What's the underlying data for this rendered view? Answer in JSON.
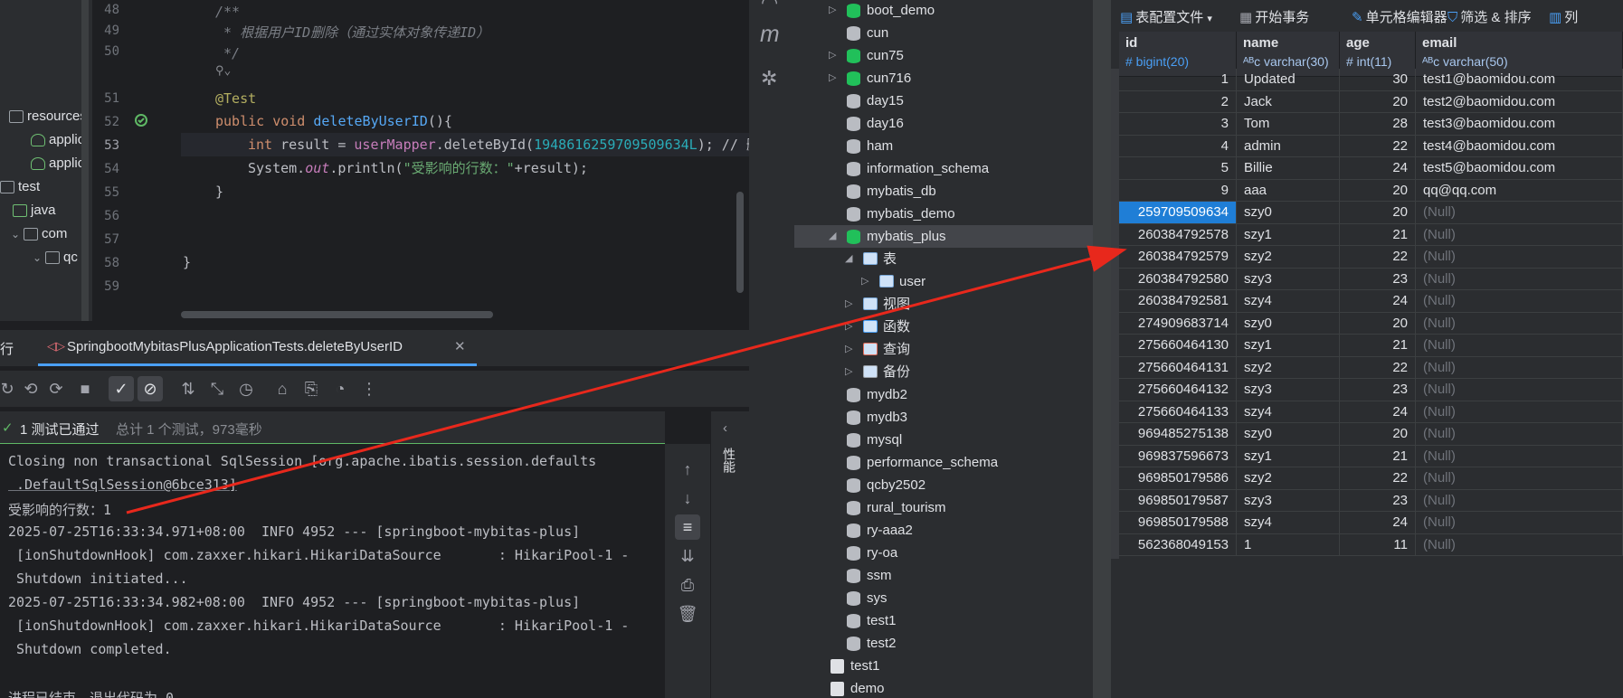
{
  "project_tree": {
    "items": [
      {
        "label": "resources",
        "icon": "folder-icon"
      },
      {
        "label": "applic",
        "icon": "leaf-icon"
      },
      {
        "label": "applic",
        "icon": "leaf-icon"
      },
      {
        "label": "test",
        "icon": "folder-icon"
      },
      {
        "label": "java",
        "icon": "folder-icon"
      },
      {
        "label": "com",
        "icon": "package-icon"
      },
      {
        "label": "qc",
        "icon": "package-icon"
      }
    ]
  },
  "editor": {
    "line_numbers": [
      "48",
      "49",
      "50",
      "51",
      "52",
      "53",
      "54",
      "55",
      "56",
      "57",
      "58",
      "59"
    ],
    "comment_1": "/**",
    "comment_2": " * 根据用户ID删除（通过实体对象传递ID）",
    "comment_3": " */",
    "annotation": "@Test",
    "kw_public": "public",
    "kw_void": "void",
    "method_name": "deleteByUserID",
    "method_tail": "(){",
    "kw_int": "int",
    "var_decl": " result = ",
    "mapper_field": "userMapper",
    "call": ".deleteById(",
    "id_literal": "1948616259709509634L",
    "call_tail": "); // 删",
    "println_start": "System.",
    "println_out": "out",
    "println_mid": ".println(",
    "println_str": "\"受影响的行数：\"",
    "println_tail": "+result);",
    "close_method": "}",
    "close_class": "}"
  },
  "run_panel": {
    "tab_prefix": "行",
    "tab_label": "SpringbootMybitasPlusApplicationTests.deleteByUserID",
    "status_passed": "1 测试已通过",
    "status_summary": "总计 1 个测试，973毫秒",
    "side_label": "性能",
    "console_lines": [
      "Closing non transactional SqlSession [org.apache.ibatis.session.defaults",
      " .DefaultSqlSession@6bce313]",
      "受影响的行数：1",
      "2025-07-25T16:33:34.971+08:00  INFO 4952 --- [springboot-mybitas-plus]",
      " [ionShutdownHook] com.zaxxer.hikari.HikariDataSource       : HikariPool-1 -",
      " Shutdown initiated...",
      "2025-07-25T16:33:34.982+08:00  INFO 4952 --- [springboot-mybitas-plus]",
      " [ionShutdownHook] com.zaxxer.hikari.HikariDataSource       : HikariPool-1 -",
      " Shutdown completed.",
      "",
      "进程已结束，退出代码为 0"
    ]
  },
  "db_nav": {
    "items": [
      {
        "label": "boot_demo",
        "kind": "db",
        "color": "#21c05a",
        "level": 0,
        "expand": "collapsed"
      },
      {
        "label": "cun",
        "kind": "db",
        "color": "#b9bcc2",
        "level": 0,
        "expand": "none"
      },
      {
        "label": "cun75",
        "kind": "db",
        "color": "#21c05a",
        "level": 0,
        "expand": "collapsed"
      },
      {
        "label": "cun716",
        "kind": "db",
        "color": "#21c05a",
        "level": 0,
        "expand": "collapsed"
      },
      {
        "label": "day15",
        "kind": "db",
        "color": "#b9bcc2",
        "level": 0,
        "expand": "none"
      },
      {
        "label": "day16",
        "kind": "db",
        "color": "#b9bcc2",
        "level": 0,
        "expand": "none"
      },
      {
        "label": "ham",
        "kind": "db",
        "color": "#b9bcc2",
        "level": 0,
        "expand": "none"
      },
      {
        "label": "information_schema",
        "kind": "db",
        "color": "#b9bcc2",
        "level": 0,
        "expand": "none"
      },
      {
        "label": "mybatis_db",
        "kind": "db",
        "color": "#b9bcc2",
        "level": 0,
        "expand": "none"
      },
      {
        "label": "mybatis_demo",
        "kind": "db",
        "color": "#b9bcc2",
        "level": 0,
        "expand": "none"
      },
      {
        "label": "mybatis_plus",
        "kind": "db",
        "color": "#21c05a",
        "level": 0,
        "expand": "expanded",
        "selected": true
      },
      {
        "label": "表",
        "kind": "folder",
        "color": "#7aa8d8",
        "level": 1,
        "expand": "expanded"
      },
      {
        "label": "user",
        "kind": "table",
        "color": "#7aa8d8",
        "level": 2,
        "expand": "collapsed"
      },
      {
        "label": "视图",
        "kind": "view",
        "color": "#7aa8d8",
        "level": 1,
        "expand": "collapsed"
      },
      {
        "label": "函数",
        "kind": "function",
        "color": "#4a9ff5",
        "level": 1,
        "expand": "collapsed"
      },
      {
        "label": "查询",
        "kind": "query",
        "color": "#e06c5a",
        "level": 1,
        "expand": "collapsed"
      },
      {
        "label": "备份",
        "kind": "backup",
        "color": "#9aa0a6",
        "level": 1,
        "expand": "collapsed"
      },
      {
        "label": "mydb2",
        "kind": "db",
        "color": "#b9bcc2",
        "level": 0,
        "expand": "none"
      },
      {
        "label": "mydb3",
        "kind": "db",
        "color": "#b9bcc2",
        "level": 0,
        "expand": "none"
      },
      {
        "label": "mysql",
        "kind": "db",
        "color": "#b9bcc2",
        "level": 0,
        "expand": "none"
      },
      {
        "label": "performance_schema",
        "kind": "db",
        "color": "#b9bcc2",
        "level": 0,
        "expand": "none"
      },
      {
        "label": "qcby2502",
        "kind": "db",
        "color": "#b9bcc2",
        "level": 0,
        "expand": "none"
      },
      {
        "label": "rural_tourism",
        "kind": "db",
        "color": "#b9bcc2",
        "level": 0,
        "expand": "none"
      },
      {
        "label": "ry-aaa2",
        "kind": "db",
        "color": "#b9bcc2",
        "level": 0,
        "expand": "none"
      },
      {
        "label": "ry-oa",
        "kind": "db",
        "color": "#b9bcc2",
        "level": 0,
        "expand": "none"
      },
      {
        "label": "ssm",
        "kind": "db",
        "color": "#b9bcc2",
        "level": 0,
        "expand": "none"
      },
      {
        "label": "sys",
        "kind": "db",
        "color": "#b9bcc2",
        "level": 0,
        "expand": "none"
      },
      {
        "label": "test1",
        "kind": "db",
        "color": "#b9bcc2",
        "level": 0,
        "expand": "none"
      },
      {
        "label": "test2",
        "kind": "db",
        "color": "#b9bcc2",
        "level": 0,
        "expand": "none"
      },
      {
        "label": "test1",
        "kind": "connection",
        "color": "#dfe1e5",
        "level": -1,
        "expand": "none"
      },
      {
        "label": "demo",
        "kind": "connection",
        "color": "#dfe1e5",
        "level": -1,
        "expand": "none"
      }
    ]
  },
  "table_view": {
    "toolbar": {
      "config_label": "表配置文件",
      "begin_tx_label": "开始事务",
      "cell_editor_label": "单元格编辑器",
      "filter_sort_label": "筛选 & 排序",
      "columns_label": "列"
    },
    "columns": [
      {
        "name": "id",
        "type": "bigint(20)"
      },
      {
        "name": "name",
        "type": "varchar(30)"
      },
      {
        "name": "age",
        "type": "int(11)"
      },
      {
        "name": "email",
        "type": "varchar(50)"
      }
    ],
    "rows": [
      [
        "1",
        "Updated",
        "30",
        "test1@baomidou.com"
      ],
      [
        "2",
        "Jack",
        "20",
        "test2@baomidou.com"
      ],
      [
        "3",
        "Tom",
        "28",
        "test3@baomidou.com"
      ],
      [
        "4",
        "admin",
        "22",
        "test4@baomidou.com"
      ],
      [
        "5",
        "Billie",
        "24",
        "test5@baomidou.com"
      ],
      [
        "9",
        "aaa",
        "20",
        "qq@qq.com"
      ],
      [
        "259709509634",
        "szy0",
        "20",
        "(Null)"
      ],
      [
        "260384792578",
        "szy1",
        "21",
        "(Null)"
      ],
      [
        "260384792579",
        "szy2",
        "22",
        "(Null)"
      ],
      [
        "260384792580",
        "szy3",
        "23",
        "(Null)"
      ],
      [
        "260384792581",
        "szy4",
        "24",
        "(Null)"
      ],
      [
        "274909683714",
        "szy0",
        "20",
        "(Null)"
      ],
      [
        "275660464130",
        "szy1",
        "21",
        "(Null)"
      ],
      [
        "275660464131",
        "szy2",
        "22",
        "(Null)"
      ],
      [
        "275660464132",
        "szy3",
        "23",
        "(Null)"
      ],
      [
        "275660464133",
        "szy4",
        "24",
        "(Null)"
      ],
      [
        "969485275138",
        "szy0",
        "20",
        "(Null)"
      ],
      [
        "969837596673",
        "szy1",
        "21",
        "(Null)"
      ],
      [
        "969850179586",
        "szy2",
        "22",
        "(Null)"
      ],
      [
        "969850179587",
        "szy3",
        "23",
        "(Null)"
      ],
      [
        "969850179588",
        "szy4",
        "24",
        "(Null)"
      ],
      [
        "562368049153",
        "1",
        "11",
        "(Null)"
      ]
    ],
    "highlighted_row": 6,
    "highlight_color": "#1f7ed6"
  },
  "annotation_arrow": {
    "color": "#e8281c"
  }
}
